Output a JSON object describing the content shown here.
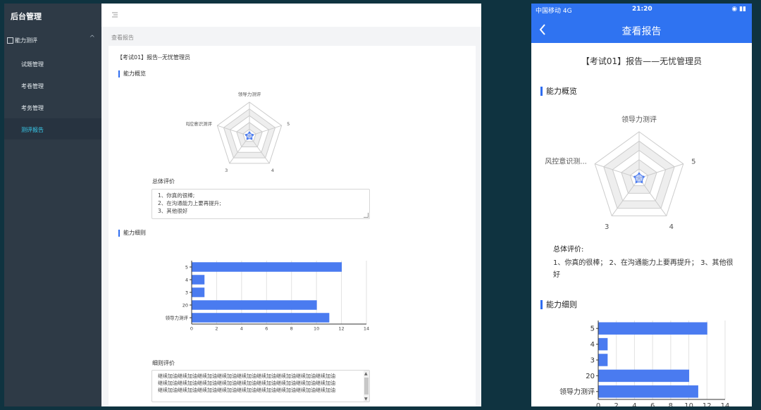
{
  "admin": {
    "brand": "后台管理",
    "menu_group": "能力测评",
    "menu_group_caret": "^",
    "menu_items": [
      "试题管理",
      "考卷管理",
      "考务管理",
      "测评报告"
    ],
    "menu_icon": "hamburger-icon",
    "breadcrumb": "查看报告",
    "report_title": "【考试01】报告--无忧管理员",
    "section_overview": "能力概览",
    "radar_labels": {
      "top": "领导力测评",
      "right": "5",
      "bottom_right": "4",
      "bottom_left": "3",
      "left": "风控意识测评"
    },
    "overall_label": "总体评价",
    "overall_lines": [
      "1、你真的很棒;",
      "2、在沟通能力上要再提升;",
      "3、其他很好"
    ],
    "section_details": "能力细则",
    "detail_label": "细则评价",
    "detail_lines": [
      "继续加油继续加油继续加油继续加油继续加油继续加油继续加油继续加油继续加油",
      "继续加油继续加油继续加油继续加油继续加油继续加油继续加油继续加油继续加油",
      "继续加油继续加油继续加油继续加油继续加油继续加油继续加油继续加油继续加油"
    ]
  },
  "mobile": {
    "carrier": "中国移动 4G",
    "time": "21:20",
    "nav_title": "查看报告",
    "back_icon": "chevron-left-icon",
    "report_title": "【考试01】报告——无忧管理员",
    "section_overview": "能力概览",
    "radar_labels": {
      "top": "领导力测评",
      "right": "5",
      "bottom_right": "4",
      "bottom_left": "3",
      "left": "风控意识测..."
    },
    "overall_label": "总体评价:",
    "overall_text": "1、你真的很棒； 2、在沟通能力上要再提升； 3、其他很好",
    "section_details": "能力细则"
  },
  "colors": {
    "accent": "#2f73f1",
    "bar": "#4a7bf0",
    "sidebar": "#2e3a46",
    "active_menu": "#39d0f2"
  },
  "chart_data": [
    {
      "type": "radar",
      "axes": [
        "领导力测评",
        "5",
        "4",
        "3",
        "风控意识测评"
      ],
      "values": [
        0.1,
        0.1,
        0.1,
        0.1,
        0.1
      ]
    },
    {
      "type": "bar",
      "orientation": "horizontal",
      "categories": [
        "5",
        "4",
        "3",
        "20",
        "领导力测评"
      ],
      "values": [
        12,
        1,
        1,
        10,
        11
      ],
      "xlim": [
        0,
        14
      ],
      "xticks": [
        0,
        2,
        4,
        6,
        8,
        10,
        12,
        14
      ],
      "grid": true
    }
  ]
}
